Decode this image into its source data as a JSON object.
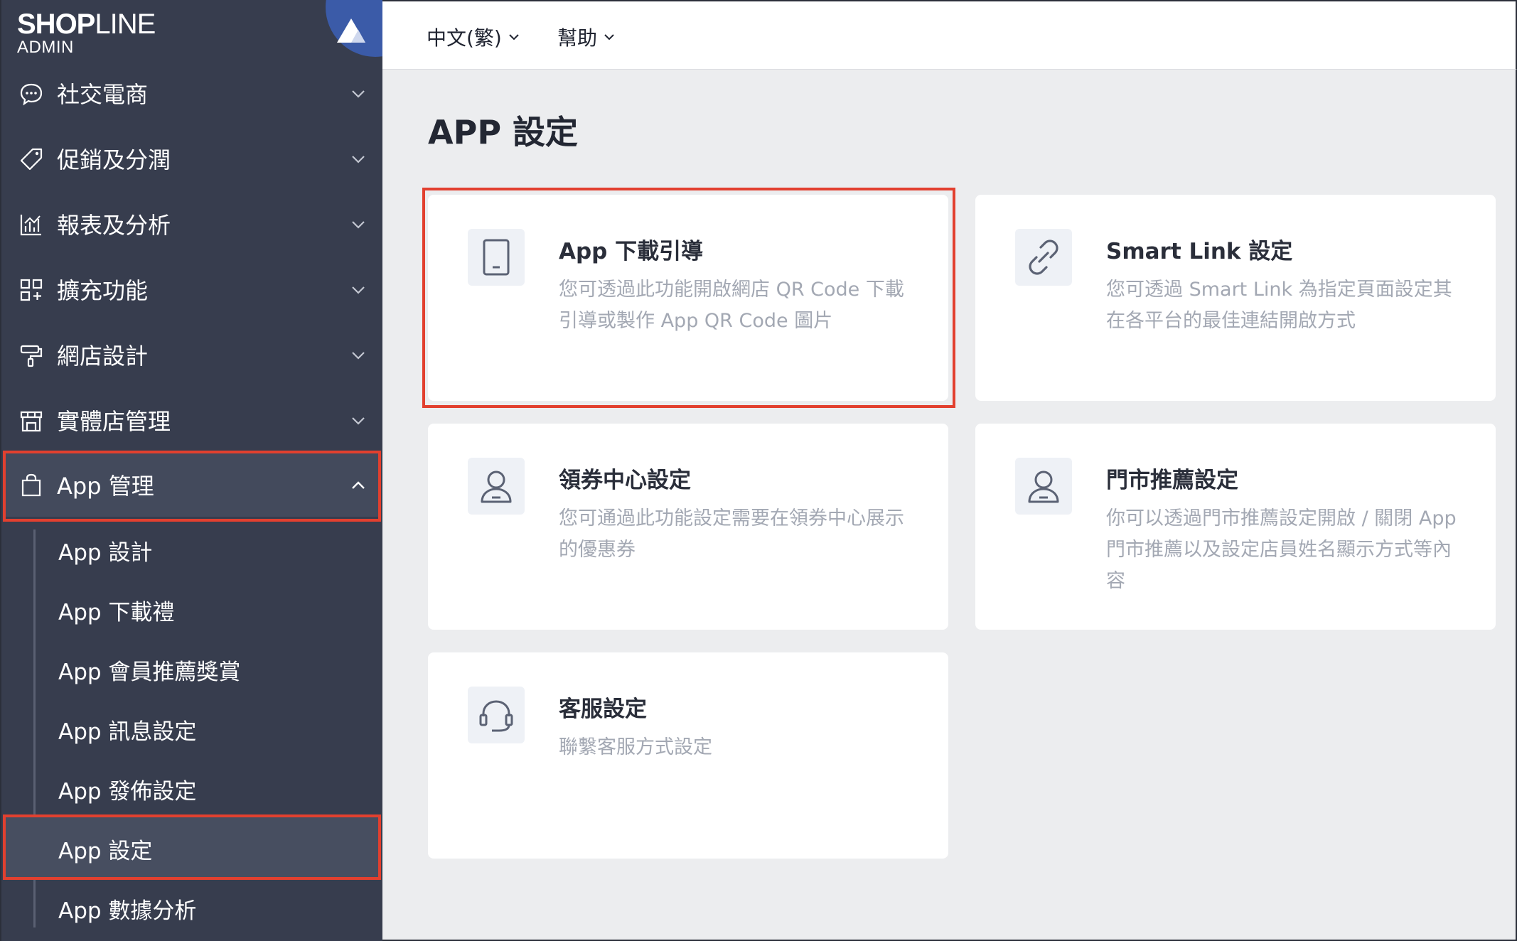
{
  "brand": {
    "name_bold": "SHOP",
    "name_light": "LINE",
    "sub": "ADMIN"
  },
  "sidebar": {
    "items": [
      {
        "label": "社交電商",
        "icon": "chat-bubble-icon"
      },
      {
        "label": "促銷及分潤",
        "icon": "tag-icon"
      },
      {
        "label": "報表及分析",
        "icon": "chart-icon"
      },
      {
        "label": "擴充功能",
        "icon": "grid-plus-icon"
      },
      {
        "label": "網店設計",
        "icon": "paint-roller-icon"
      },
      {
        "label": "實體店管理",
        "icon": "store-icon"
      },
      {
        "label": "App 管理",
        "icon": "shopping-bag-icon"
      }
    ],
    "subitems": [
      {
        "label": "App 設計"
      },
      {
        "label": "App 下載禮"
      },
      {
        "label": "App 會員推薦獎賞"
      },
      {
        "label": "App 訊息設定"
      },
      {
        "label": "App 發佈設定"
      },
      {
        "label": "App 設定"
      },
      {
        "label": "App 數據分析"
      }
    ]
  },
  "topbar": {
    "language": "中文(繁)",
    "help": "幫助"
  },
  "main": {
    "title": "APP 設定",
    "cards": [
      {
        "title": "App 下載引導",
        "desc": "您可透過此功能開啟網店 QR Code 下載引導或製作 App QR Code 圖片",
        "icon": "tablet-icon"
      },
      {
        "title": "Smart Link 設定",
        "desc": "您可透過 Smart Link 為指定頁面設定其在各平台的最佳連結開啟方式",
        "icon": "link-icon"
      },
      {
        "title": "領券中心設定",
        "desc": "您可通過此功能設定需要在領券中心展示的優惠券",
        "icon": "user-icon"
      },
      {
        "title": "門市推薦設定",
        "desc": "你可以透過門市推薦設定開啟 / 關閉 App 門市推薦以及設定店員姓名顯示方式等內容",
        "icon": "user-icon"
      },
      {
        "title": "客服設定",
        "desc": "聯繫客服方式設定",
        "icon": "headset-icon"
      }
    ]
  },
  "colors": {
    "sidebar_bg": "#373d4e",
    "highlight": "#e2402f",
    "page_bg": "#ecedef"
  }
}
